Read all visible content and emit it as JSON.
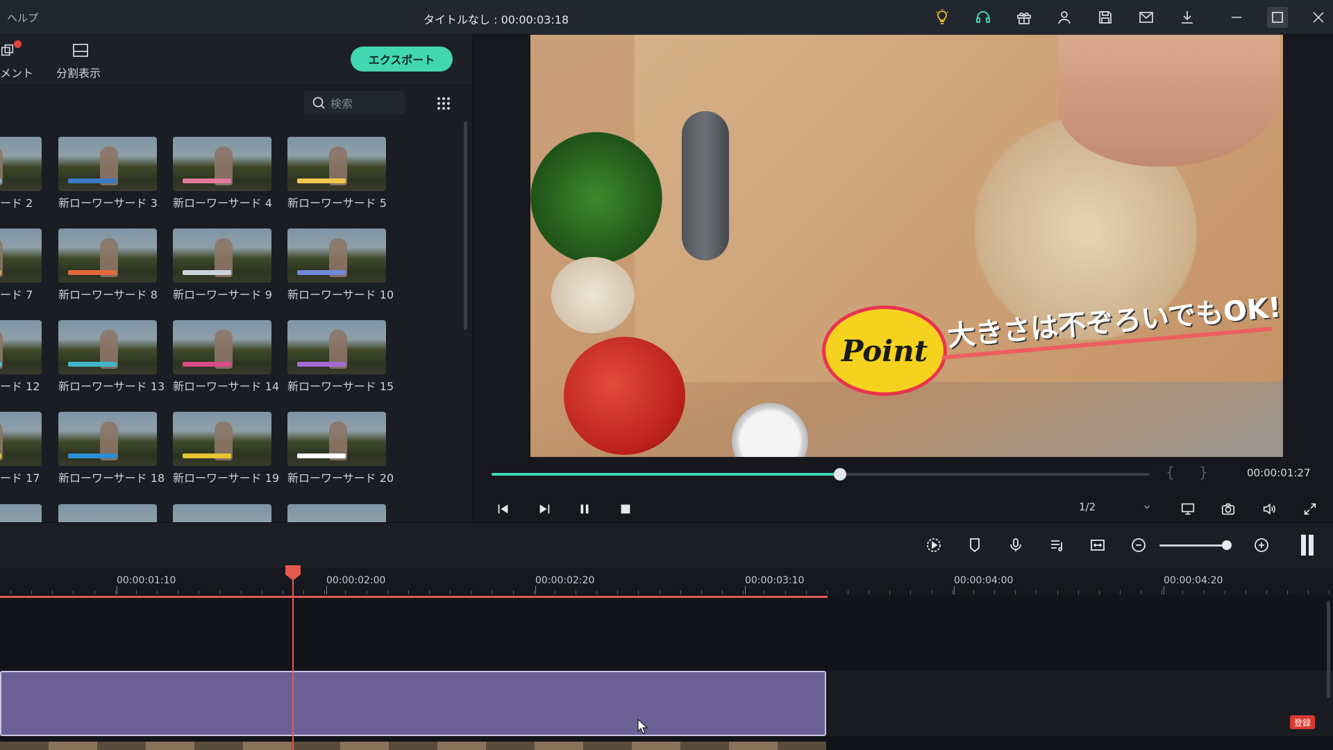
{
  "titlebar": {
    "menu_help": "ヘルプ",
    "title": "タイトルなし : 00:00:03:18",
    "icons": [
      "bulb-icon",
      "headset-icon",
      "gift-icon",
      "account-icon",
      "save-icon",
      "mail-icon",
      "download-icon",
      "minimize-icon",
      "maximize-icon",
      "close-icon"
    ]
  },
  "left_toolbar": {
    "comment_label": "メント",
    "split_view_label": "分割表示",
    "export_label": "エクスポート"
  },
  "search": {
    "placeholder": "検索"
  },
  "presets": {
    "rows": [
      [
        "ード 2",
        "新ローワーサード 3",
        "新ローワーサード 4",
        "新ローワーサード 5"
      ],
      [
        "ード 7",
        "新ローワーサード 8",
        "新ローワーサード 9",
        "新ローワーサード 10"
      ],
      [
        "ード 12",
        "新ローワーサード 13",
        "新ローワーサード 14",
        "新ローワーサード 15"
      ],
      [
        "ード 17",
        "新ローワーサード 18",
        "新ローワーサード 19",
        "新ローワーサード 20"
      ]
    ],
    "bar_colors": [
      [
        "#7fb7d6",
        "#3a79c4",
        "#e07b9b",
        "#f2c84b"
      ],
      [
        "#d9a15c",
        "#e36a3b",
        "#cfd3da",
        "#6f8ad6"
      ],
      [
        "#4ac2e0",
        "#3fb7c9",
        "#d94a86",
        "#a36ad6"
      ],
      [
        "#e0c23a",
        "#2a8fd6",
        "#e8c530",
        "#ffffff"
      ]
    ]
  },
  "preview": {
    "overlay_point": "Point",
    "overlay_caption": "大きさは不ぞろいでもOK!",
    "time": "00:00:01:27",
    "progress": 0.53,
    "page": "1/2"
  },
  "timeline": {
    "ruler_labels": [
      "00:00:01:10",
      "00:00:02:00",
      "00:00:02:20",
      "00:00:03:10",
      "00:00:04:00",
      "00:00:04:20"
    ],
    "badge": "登録"
  },
  "colors": {
    "accent": "#42d6b2",
    "playhead": "#e5584e",
    "clip": "#6b6096"
  }
}
